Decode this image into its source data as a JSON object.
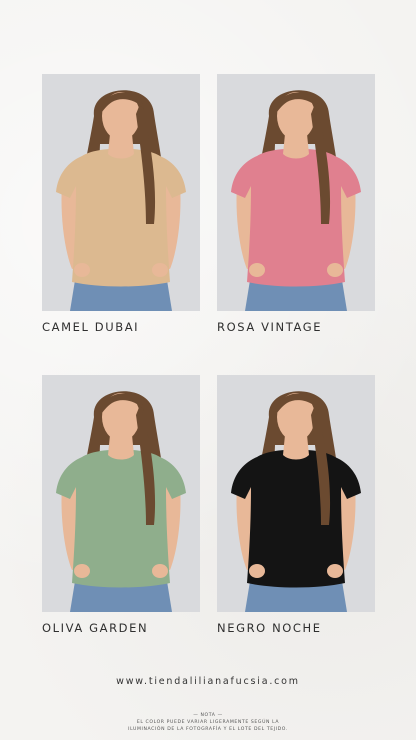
{
  "products": [
    {
      "name": "CAMEL DUBAI",
      "shirt_color": "#dcb990"
    },
    {
      "name": "ROSA VINTAGE",
      "shirt_color": "#e0808f"
    },
    {
      "name": "OLIVA GARDEN",
      "shirt_color": "#8fae8c"
    },
    {
      "name": "NEGRO NOCHE",
      "shirt_color": "#141414"
    }
  ],
  "website": "www.tiendalilianafucsia.com",
  "note": {
    "title": "— NOTA —",
    "line1": "EL COLOR PUEDE VARIAR LIGERAMENTE SEGÚN LA",
    "line2": "ILUMINACIÓN DE LA FOTOGRAFÍA Y EL LOTE DEL TEJIDO."
  },
  "colors": {
    "background": "#f4f3f1",
    "photo_background": "#d8d9dc",
    "hair": "#6b4a30",
    "skin": "#e8b898",
    "jeans": "#6f8fb5"
  }
}
